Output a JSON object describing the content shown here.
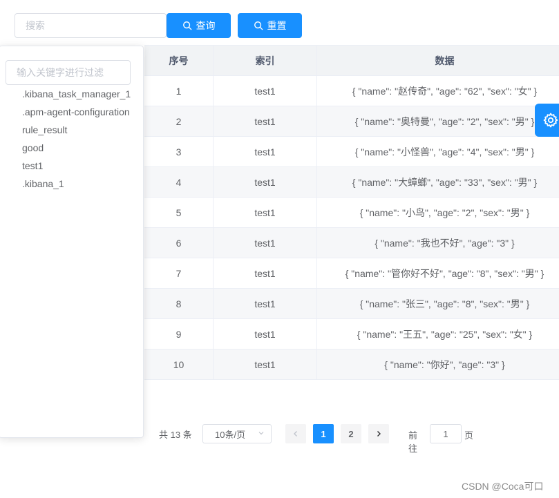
{
  "toolbar": {
    "search_placeholder": "搜索",
    "query_label": "查询",
    "reset_label": "重置"
  },
  "filter_panel": {
    "placeholder": "输入关键字进行过滤",
    "items": [
      ".kibana_task_manager_1",
      ".apm-agent-configuration",
      "rule_result",
      "good",
      "test1",
      ".kibana_1"
    ]
  },
  "table": {
    "headers": [
      "序号",
      "索引",
      "数据"
    ],
    "rows": [
      {
        "no": "1",
        "index": "test1",
        "data": "{ \"name\": \"赵传奇\", \"age\": \"62\", \"sex\": \"女\" }"
      },
      {
        "no": "2",
        "index": "test1",
        "data": "{ \"name\": \"奥特曼\", \"age\": \"2\", \"sex\": \"男\" }"
      },
      {
        "no": "3",
        "index": "test1",
        "data": "{ \"name\": \"小怪兽\", \"age\": \"4\", \"sex\": \"男\" }"
      },
      {
        "no": "4",
        "index": "test1",
        "data": "{ \"name\": \"大蟑螂\", \"age\": \"33\", \"sex\": \"男\" }"
      },
      {
        "no": "5",
        "index": "test1",
        "data": "{ \"name\": \"小鸟\", \"age\": \"2\", \"sex\": \"男\" }"
      },
      {
        "no": "6",
        "index": "test1",
        "data": "{ \"name\": \"我也不好\", \"age\": \"3\" }"
      },
      {
        "no": "7",
        "index": "test1",
        "data": "{ \"name\": \"管你好不好\", \"age\": \"8\", \"sex\": \"男\" }"
      },
      {
        "no": "8",
        "index": "test1",
        "data": "{ \"name\": \"张三\", \"age\": \"8\", \"sex\": \"男\" }"
      },
      {
        "no": "9",
        "index": "test1",
        "data": "{ \"name\": \"王五\", \"age\": \"25\", \"sex\": \"女\" }"
      },
      {
        "no": "10",
        "index": "test1",
        "data": "{ \"name\": \"你好\", \"age\": \"3\" }"
      }
    ]
  },
  "pagination": {
    "total_text": "共 13 条",
    "page_size_text": "10条/页",
    "pages": [
      "1",
      "2"
    ],
    "current_page": "1",
    "jumper_prefix": "前往",
    "jumper_value": "1",
    "jumper_suffix": "页"
  },
  "watermark": "CSDN @Coca可口",
  "colors": {
    "primary": "#1890ff",
    "header_bg": "#f1f3f5",
    "border": "#ebeef5"
  },
  "icons": {
    "query": "search-icon",
    "reset": "search-icon",
    "settings": "gear-icon",
    "prev": "chevron-left-icon",
    "next": "chevron-right-icon",
    "select": "chevron-down-icon"
  }
}
